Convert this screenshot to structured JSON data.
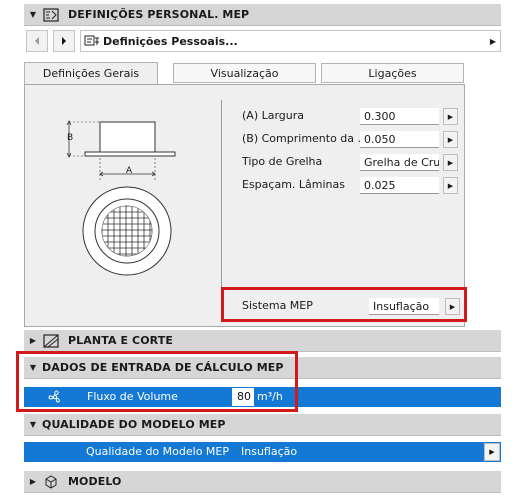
{
  "colors": {
    "selection_blue": "#1479d4",
    "highlight_red": "#d11a1a",
    "header_gray": "#d6d6d6"
  },
  "header": {
    "title": "DEFINIÇÕES PERSONAL. MEP",
    "icon": "mep-settings-icon"
  },
  "nav": {
    "favorite": "Definições Pessoais...",
    "favorite_icon": "mep-favorite-icon"
  },
  "tabs": [
    {
      "label": "Definições Gerais",
      "active": true
    },
    {
      "label": "Visualização",
      "active": false
    },
    {
      "label": "Ligações",
      "active": false
    }
  ],
  "diagram": {
    "label_a": "A",
    "label_b": "B"
  },
  "params": [
    {
      "label": "(A) Largura",
      "value": "0.300"
    },
    {
      "label": "(B) Comprimento da ...",
      "value": "0.050"
    },
    {
      "label": "Tipo de Grelha",
      "value": "Grelha de Cruz"
    },
    {
      "label": "Espaçam. Lâminas",
      "value": "0.025"
    }
  ],
  "system": {
    "label": "Sistema MEP",
    "value": "Insuflação"
  },
  "sections": {
    "planta": "PLANTA E CORTE",
    "dados": "DADOS DE ENTRADA DE CÁLCULO MEP",
    "qualidade": "QUALIDADE DO MODELO MEP",
    "modelo": "MODELO"
  },
  "flow": {
    "label": "Fluxo de Volume",
    "value": "80",
    "unit": "m³/h",
    "icon": "fan-icon"
  },
  "quality": {
    "label": "Qualidade do Modelo MEP",
    "value": "Insuflação"
  }
}
